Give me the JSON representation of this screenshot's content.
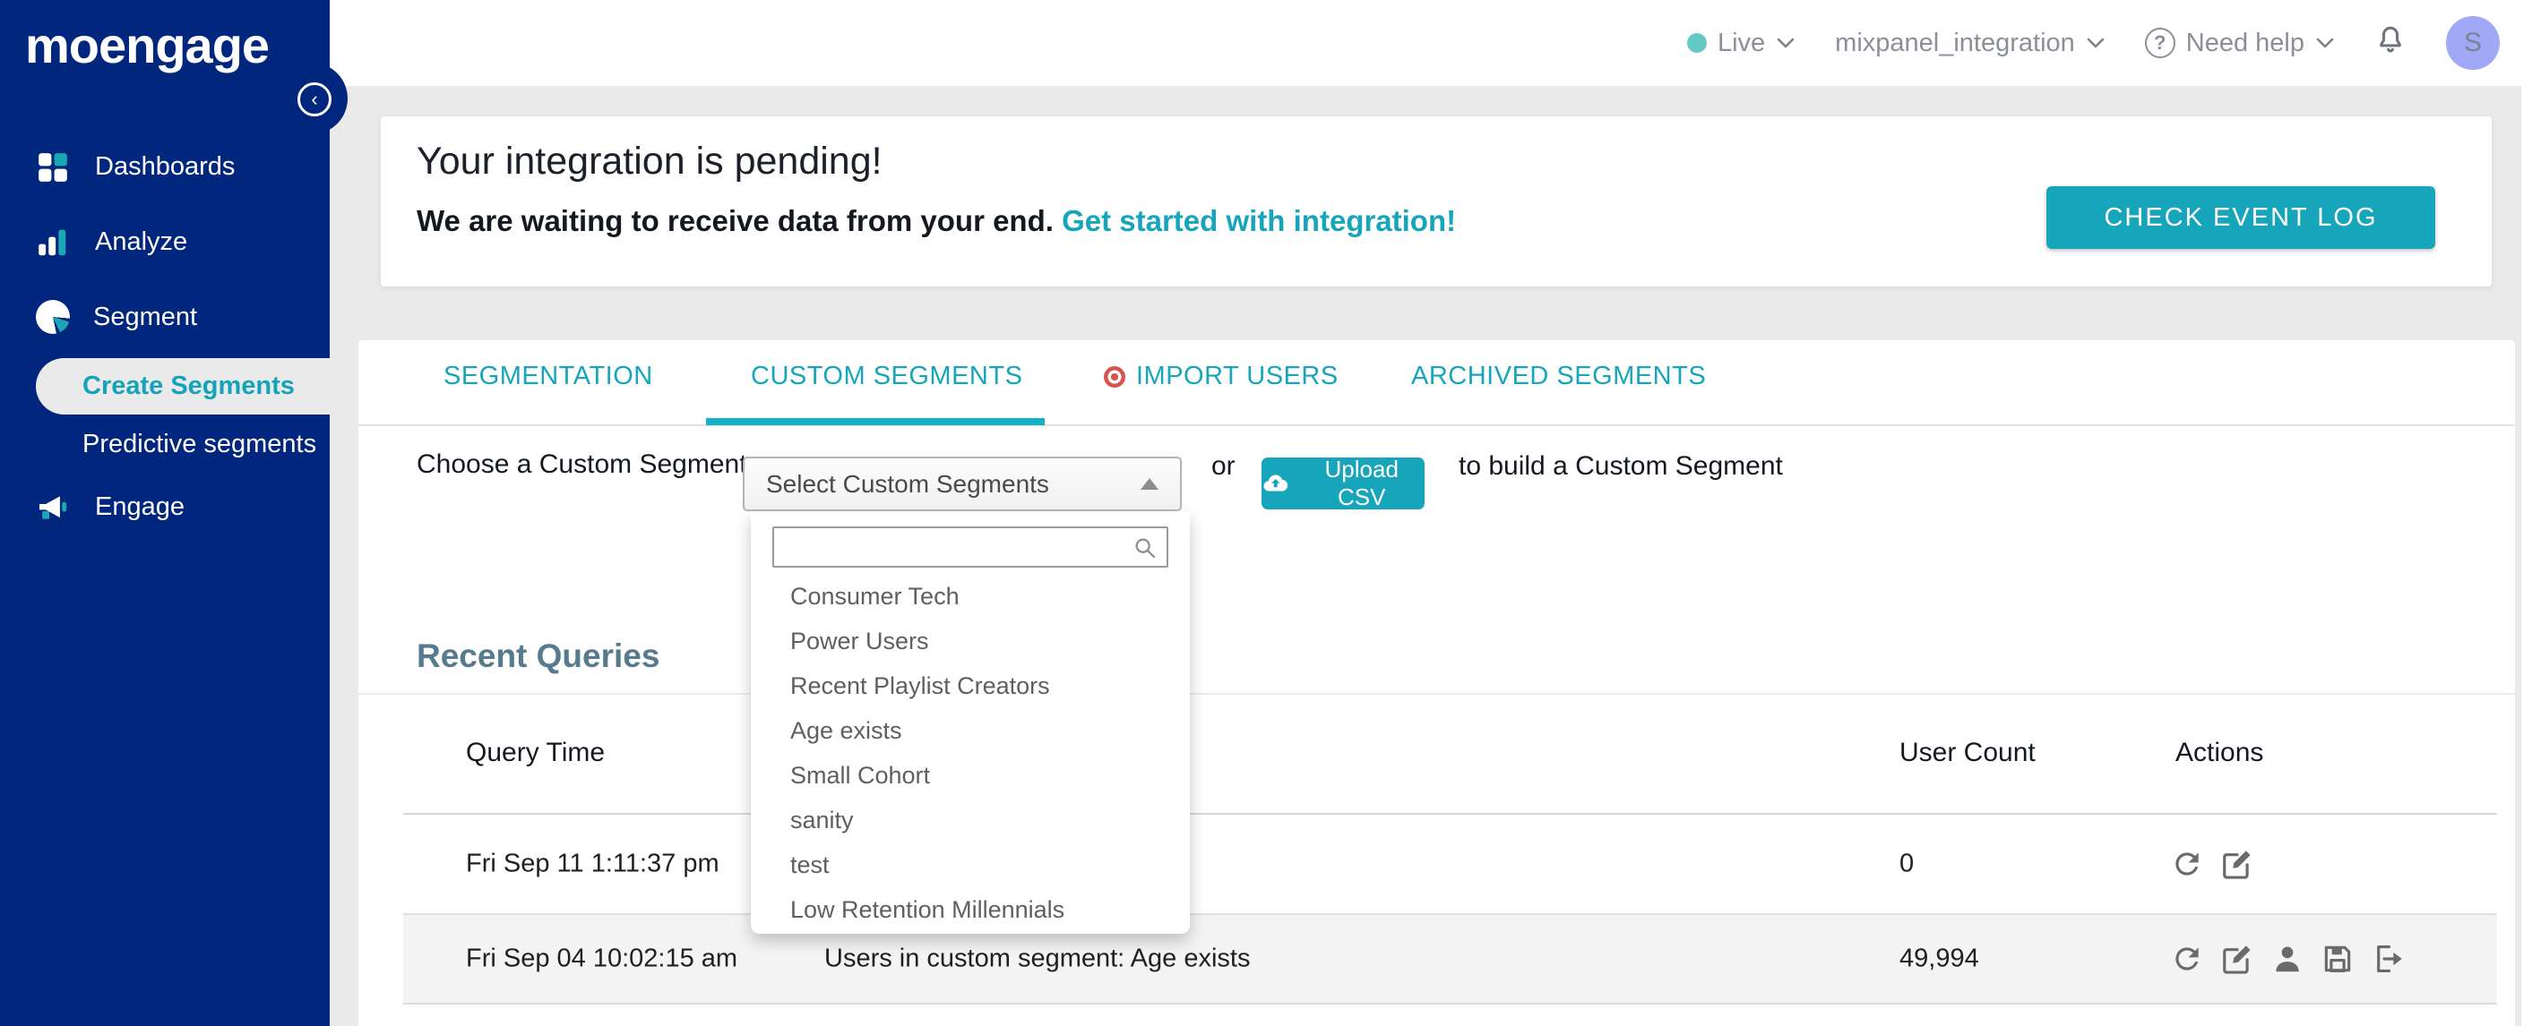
{
  "colors": {
    "navy": "#00267E",
    "teal": "#16A5BB",
    "live_dot": "#63C9C3",
    "avatar_bg": "#A0A9F7",
    "heading_slate": "#567A8E",
    "red_badge": "#D9534F",
    "content_bg": "#EAEAEA",
    "row_alt_bg": "#F4F4F4"
  },
  "sidebar": {
    "logo": "moengage",
    "collapse_icon": "chevron-left",
    "items": [
      {
        "label": "Dashboards",
        "icon": "grid-icon"
      },
      {
        "label": "Analyze",
        "icon": "bar-chart-icon"
      },
      {
        "label": "Segment",
        "icon": "pie-chart-icon"
      },
      {
        "label": "Engage",
        "icon": "megaphone-icon"
      }
    ],
    "sub_items": [
      {
        "label": "Create Segments",
        "active": true
      },
      {
        "label": "Predictive segments",
        "active": false
      }
    ]
  },
  "header": {
    "live_label": "Live",
    "workspace": "mixpanel_integration",
    "help_label": "Need help",
    "avatar_initial": "S"
  },
  "banner": {
    "title": "Your integration is pending!",
    "subtitle": "We are waiting to receive data from your end.",
    "link_text": "Get started with integration!",
    "button_label": "CHECK EVENT LOG"
  },
  "tabs": [
    {
      "label": "SEGMENTATION",
      "active": false
    },
    {
      "label": "CUSTOM SEGMENTS",
      "active": true
    },
    {
      "label": "IMPORT USERS",
      "active": false,
      "badge": "red-target-icon"
    },
    {
      "label": "ARCHIVED SEGMENTS",
      "active": false
    }
  ],
  "segment_chooser": {
    "label": "Choose a Custom Segment:",
    "select_value": "Select Custom Segments",
    "or_text": "or",
    "upload_button_label": "Upload CSV",
    "suffix_text": "to build a Custom Segment",
    "search_value": "",
    "options": [
      "Consumer Tech",
      "Power Users",
      "Recent Playlist Creators",
      "Age exists",
      "Small Cohort",
      "sanity",
      "test",
      "Low Retention Millennials"
    ]
  },
  "recent_queries": {
    "title": "Recent Queries",
    "columns": [
      "Query Time",
      "",
      "User Count",
      "Actions"
    ],
    "rows": [
      {
        "time": "Fri Sep 11 1:11:37 pm",
        "query": "",
        "user_count": "0",
        "actions": [
          "refresh",
          "edit"
        ]
      },
      {
        "time": "Fri Sep 04 10:02:15 am",
        "query": "Users in custom segment: Age exists",
        "user_count": "49,994",
        "actions": [
          "refresh",
          "edit",
          "user",
          "save",
          "sign-out"
        ]
      }
    ]
  }
}
